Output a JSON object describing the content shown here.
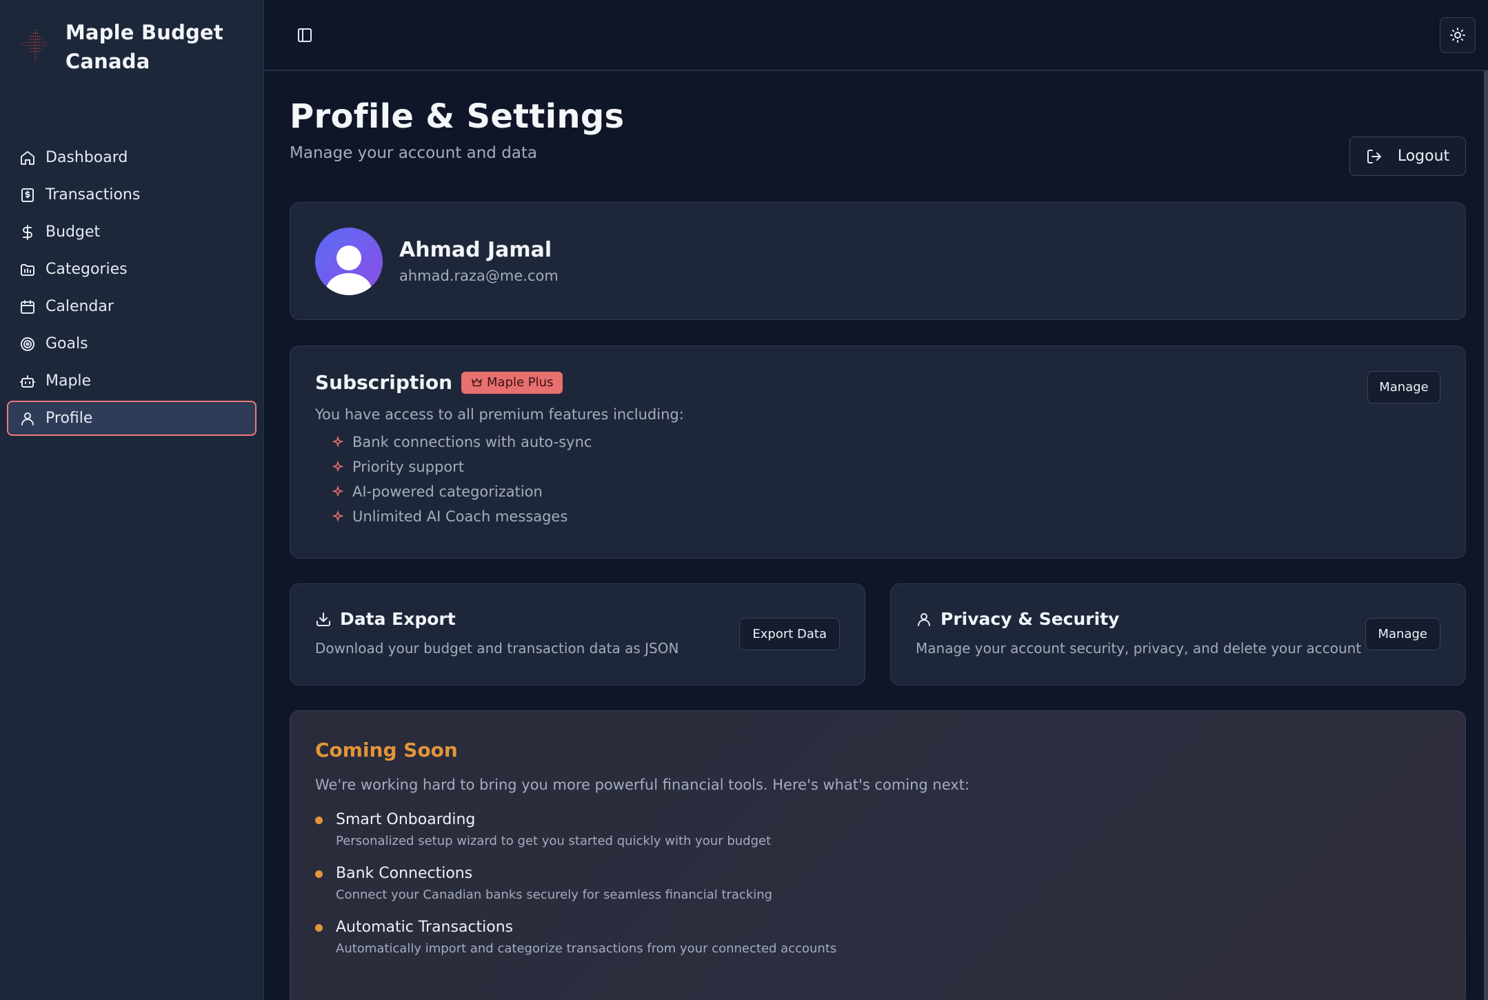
{
  "brand": {
    "name": "Maple Budget Canada",
    "logo_icon": "maple-leaf-icon",
    "logo_color": "#c0392b"
  },
  "sidebar": {
    "items": [
      {
        "label": "Dashboard",
        "icon": "home-icon"
      },
      {
        "label": "Transactions",
        "icon": "receipt-icon"
      },
      {
        "label": "Budget",
        "icon": "dollar-icon"
      },
      {
        "label": "Categories",
        "icon": "folder-icon"
      },
      {
        "label": "Calendar",
        "icon": "calendar-icon"
      },
      {
        "label": "Goals",
        "icon": "target-icon"
      },
      {
        "label": "Maple",
        "icon": "bot-icon"
      },
      {
        "label": "Profile",
        "icon": "user-icon",
        "active": true
      }
    ]
  },
  "topbar": {
    "toggle_icon": "sidebar-toggle-icon",
    "theme_icon": "sun-icon"
  },
  "page": {
    "title": "Profile & Settings",
    "subtitle": "Manage your account and data",
    "logout_label": "Logout"
  },
  "profile": {
    "name": "Ahmad Jamal",
    "email": "ahmad.raza@me.com"
  },
  "subscription": {
    "title": "Subscription",
    "badge": "Maple Plus",
    "manage_label": "Manage",
    "description": "You have access to all premium features including:",
    "features": [
      "Bank connections with auto-sync",
      "Priority support",
      "AI-powered categorization",
      "Unlimited AI Coach messages"
    ]
  },
  "data_export": {
    "title": "Data Export",
    "description": "Download your budget and transaction data as JSON",
    "button": "Export Data"
  },
  "privacy": {
    "title": "Privacy & Security",
    "description": "Manage your account security, privacy, and delete your account",
    "button": "Manage"
  },
  "coming_soon": {
    "title": "Coming Soon",
    "description": "We're working hard to bring you more powerful financial tools. Here's what's coming next:",
    "items": [
      {
        "title": "Smart Onboarding",
        "desc": "Personalized setup wizard to get you started quickly with your budget"
      },
      {
        "title": "Bank Connections",
        "desc": "Connect your Canadian banks securely for seamless financial tracking"
      },
      {
        "title": "Automatic Transactions",
        "desc": "Automatically import and categorize transactions from your connected accounts"
      }
    ]
  },
  "colors": {
    "accent": "#e8706f",
    "coming_soon": "#e3953a",
    "background": "#0f1628",
    "sidebar": "#1d273a"
  }
}
